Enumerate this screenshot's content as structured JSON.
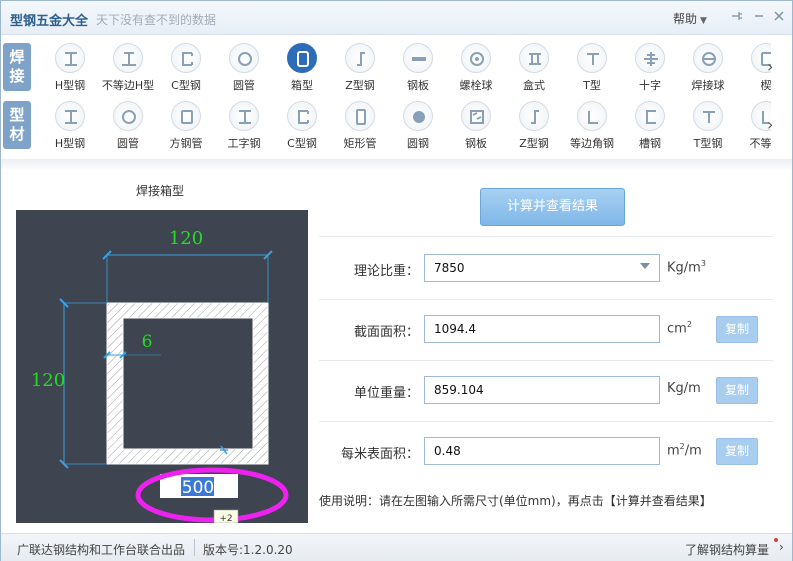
{
  "app": {
    "title": "型钢五金大全",
    "slogan": "天下没有查不到的数据",
    "help_label": "帮助"
  },
  "weld_row": {
    "tab_label_1": "焊",
    "tab_label_2": "接",
    "items": [
      {
        "label": "H型钢",
        "icon": "h-beam-icon"
      },
      {
        "label": "不等边H型",
        "icon": "unequal-h-beam-icon"
      },
      {
        "label": "C型钢",
        "icon": "c-channel-icon"
      },
      {
        "label": "圆管",
        "icon": "round-pipe-icon"
      },
      {
        "label": "箱型",
        "icon": "box-section-icon",
        "active": true
      },
      {
        "label": "Z型钢",
        "icon": "z-section-icon"
      },
      {
        "label": "钢板",
        "icon": "steel-plate-icon"
      },
      {
        "label": "螺栓球",
        "icon": "bolt-ball-icon"
      },
      {
        "label": "盒式",
        "icon": "box-type-icon"
      },
      {
        "label": "T型",
        "icon": "t-section-icon"
      },
      {
        "label": "十字",
        "icon": "cross-section-icon"
      },
      {
        "label": "焊接球",
        "icon": "welded-ball-icon"
      },
      {
        "label": "楔",
        "icon": "wedge-icon"
      }
    ]
  },
  "profile_row": {
    "tab_label_1": "型",
    "tab_label_2": "材",
    "items": [
      {
        "label": "H型钢",
        "icon": "h-beam-icon"
      },
      {
        "label": "圆管",
        "icon": "round-pipe-icon"
      },
      {
        "label": "方钢管",
        "icon": "square-tube-icon"
      },
      {
        "label": "工字钢",
        "icon": "i-beam-icon"
      },
      {
        "label": "C型钢",
        "icon": "c-channel-icon"
      },
      {
        "label": "矩形管",
        "icon": "rect-tube-icon"
      },
      {
        "label": "圆钢",
        "icon": "round-bar-icon"
      },
      {
        "label": "钢板",
        "icon": "checker-plate-icon"
      },
      {
        "label": "Z型钢",
        "icon": "z-section-icon"
      },
      {
        "label": "等边角钢",
        "icon": "equal-angle-icon"
      },
      {
        "label": "槽钢",
        "icon": "channel-icon"
      },
      {
        "label": "T型钢",
        "icon": "t-section-icon"
      },
      {
        "label": "不等边",
        "icon": "unequal-angle-icon"
      }
    ]
  },
  "diagram": {
    "title": "焊接箱型",
    "width_dim": "120",
    "height_dim": "120",
    "thickness_dim": "6",
    "length_value": "500",
    "tooltip": "+2"
  },
  "form": {
    "calc_button": "计算并查看结果",
    "rows": [
      {
        "label": "理论比重：",
        "value": "7850",
        "unit_main": "Kg/m",
        "unit_sup": "3",
        "unit_suffix": "",
        "unit_prefix": "",
        "has_copy": false,
        "is_select": true
      },
      {
        "label": "截面面积：",
        "value": "1094.4",
        "unit_main": "cm",
        "unit_sup": "2",
        "unit_suffix": "",
        "unit_prefix": "",
        "has_copy": true
      },
      {
        "label": "单位重量：",
        "value": "859.104",
        "unit_main": "Kg/m",
        "unit_sup": "",
        "unit_suffix": "",
        "unit_prefix": "",
        "has_copy": true
      },
      {
        "label": "每米表面积：",
        "value": "0.48",
        "unit_main": "m",
        "unit_sup": "2",
        "unit_suffix": "/m",
        "unit_prefix": "",
        "has_copy": true
      }
    ],
    "copy_label": "复制",
    "usage": "使用说明：请在左图输入所需尺寸(单位mm)，再点击【计算并查看结果】"
  },
  "status": {
    "left": "广联达钢结构和工作台联合出品",
    "version": "版本号:1.2.0.20",
    "right": "了解钢结构算量"
  },
  "colors": {
    "accent": "#2d6db8",
    "dim_text": "#22dd22",
    "highlight_ring": "#ee22ee"
  }
}
